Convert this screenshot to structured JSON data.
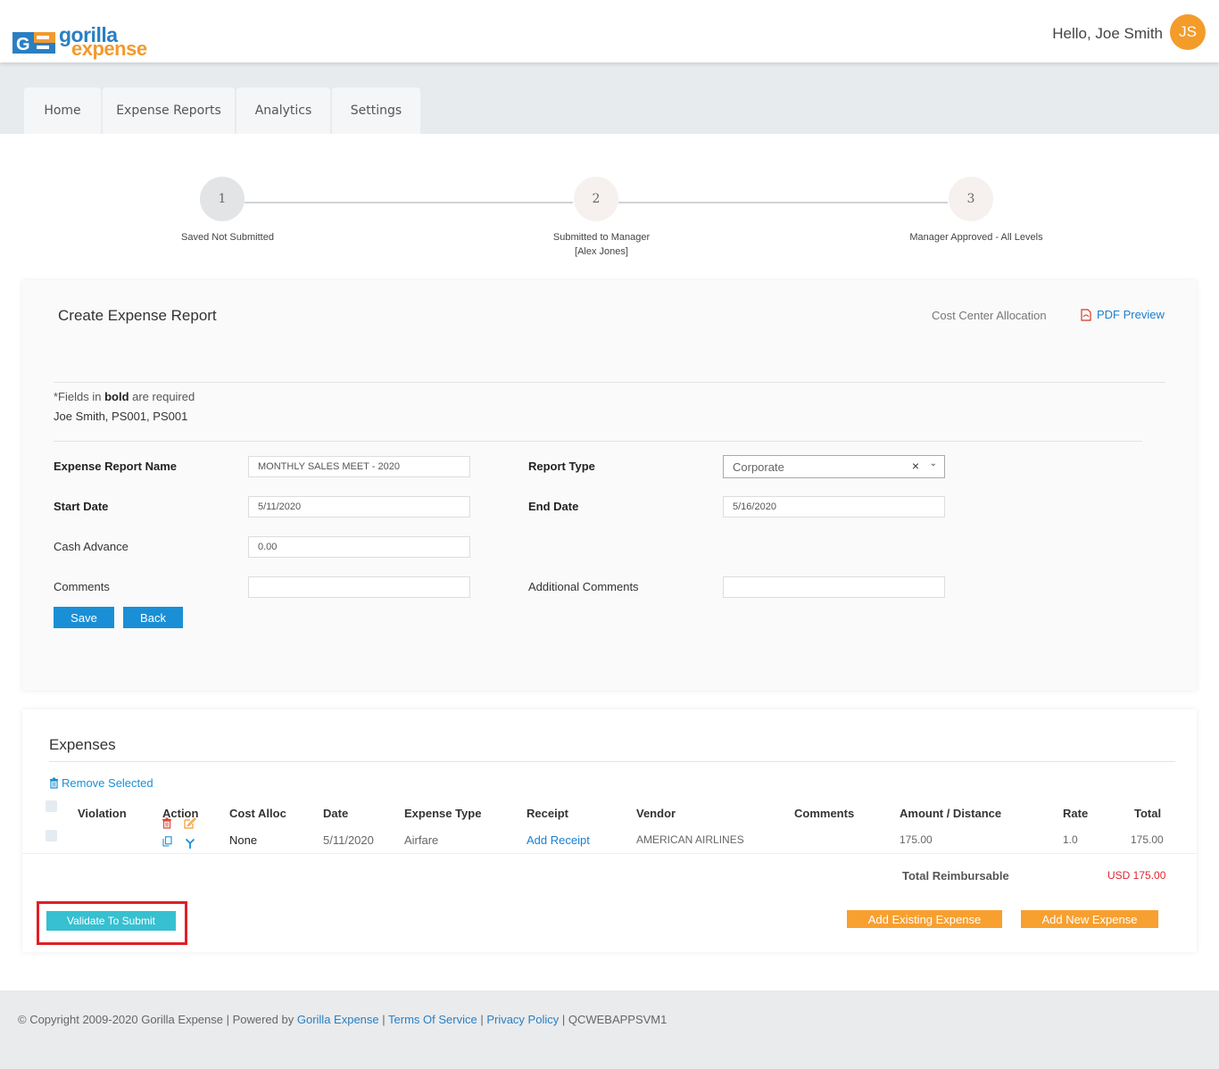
{
  "brand": {
    "name_line1": "gorilla",
    "name_line2": "expense",
    "logo_letters": "GE"
  },
  "header": {
    "greeting": "Hello, Joe Smith",
    "avatar_initials": "JS"
  },
  "nav": {
    "tabs": [
      "Home",
      "Expense Reports",
      "Analytics",
      "Settings"
    ]
  },
  "stepper": {
    "steps": [
      {
        "number": "1",
        "label": "Saved Not Submitted",
        "label2": ""
      },
      {
        "number": "2",
        "label": "Submitted to Manager",
        "label2": "[Alex Jones]"
      },
      {
        "number": "3",
        "label": "Manager Approved - All Levels",
        "label2": ""
      }
    ]
  },
  "report": {
    "title": "Create Expense Report",
    "cost_center_link": "Cost Center Allocation",
    "pdf_preview_link": "PDF Preview",
    "required_prefix": "*Fields in ",
    "required_bold": "bold",
    "required_suffix": " are required",
    "employee_line": "Joe Smith, PS001, PS001",
    "fields": {
      "name_label": "Expense Report Name",
      "name_value": "MONTHLY SALES MEET - 2020",
      "type_label": "Report Type",
      "type_value": "Corporate",
      "start_label": "Start Date",
      "start_value": "5/11/2020",
      "end_label": "End Date",
      "end_value": "5/16/2020",
      "cash_label": "Cash Advance",
      "cash_value": "0.00",
      "comments_label": "Comments",
      "comments_value": "",
      "additional_label": "Additional Comments",
      "additional_value": ""
    },
    "save_label": "Save",
    "back_label": "Back"
  },
  "expenses": {
    "title": "Expenses",
    "remove_selected": "Remove Selected",
    "columns": [
      "Violation",
      "Action",
      "Cost Alloc",
      "Date",
      "Expense Type",
      "Receipt",
      "Vendor",
      "Comments",
      "Amount / Distance",
      "Rate",
      "Total"
    ],
    "rows": [
      {
        "violation": "",
        "cost_alloc": "None",
        "date": "5/11/2020",
        "expense_type": "Airfare",
        "receipt": "Add Receipt",
        "vendor": "AMERICAN AIRLINES",
        "comments": "",
        "amount": "175.00",
        "rate": "1.0",
        "total": "175.00"
      }
    ],
    "total_label": "Total Reimbursable",
    "total_value": "USD 175.00",
    "validate_label": "Validate To Submit",
    "add_existing_label": "Add Existing Expense",
    "add_new_label": "Add New Expense"
  },
  "footer": {
    "copyright": "© Copyright 2009-2020 Gorilla Expense | Powered by ",
    "powered_link": "Gorilla Expense",
    "sep1": " | ",
    "terms_link": "Terms Of Service",
    "sep2": " | ",
    "privacy_link": "Privacy Policy",
    "server": " | QCWEBAPPSVM1"
  },
  "colors": {
    "accent_blue": "#1a8fd6",
    "accent_orange": "#f7a030",
    "teal": "#36c0d0",
    "highlight_red": "#e01e24"
  }
}
